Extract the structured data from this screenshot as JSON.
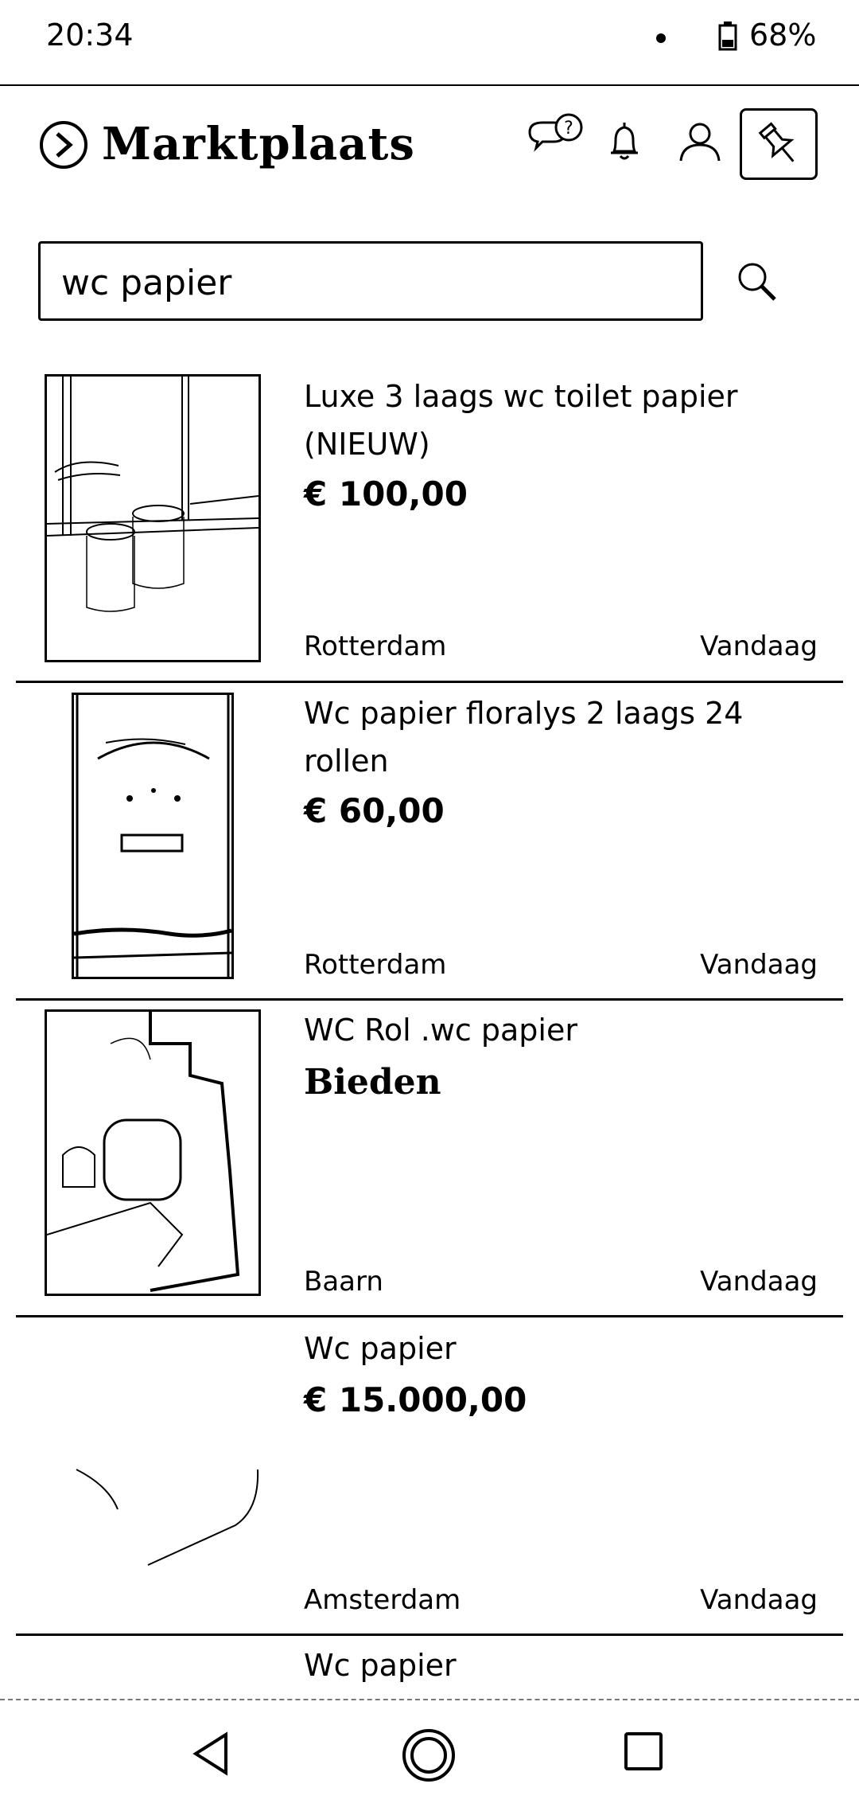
{
  "status_bar": {
    "time": "20:34",
    "battery": "68%"
  },
  "header": {
    "app_title": "Marktplaats",
    "icons": [
      "chevron-circle-icon",
      "chat-help-icon",
      "bell-icon",
      "user-icon",
      "pin-icon"
    ]
  },
  "search": {
    "value": "wc papier",
    "icon": "search-icon"
  },
  "listings": [
    {
      "title": "Luxe 3 laags wc toilet papier (NIEUW)",
      "price": "€ 100,00",
      "location": "Rotterdam",
      "date": "Vandaag"
    },
    {
      "title": "Wc papier floralys 2 laags 24 rollen",
      "price": "€ 60,00",
      "location": "Rotterdam",
      "date": "Vandaag"
    },
    {
      "title": "WC Rol .wc papier",
      "price": "Bieden",
      "location": "Baarn",
      "date": "Vandaag"
    },
    {
      "title": "Wc papier",
      "price": "€ 15.000,00",
      "location": "Amsterdam",
      "date": "Vandaag"
    },
    {
      "title": "Wc papier"
    }
  ],
  "nav_bar": {
    "icons": [
      "back-icon",
      "home-icon",
      "recents-icon"
    ]
  },
  "colors": {
    "foreground": "#000000",
    "background": "#ffffff"
  }
}
